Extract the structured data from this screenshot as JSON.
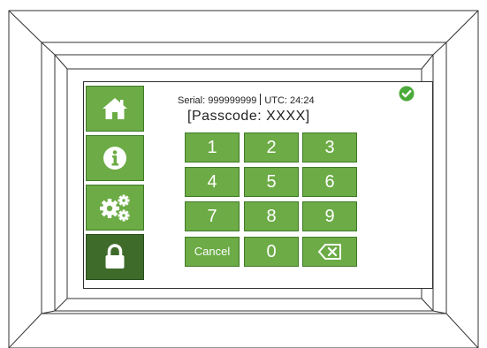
{
  "device": {
    "serial_label": "Serial:",
    "serial_value": "999999999",
    "utc_label": "UTC:",
    "utc_value": "24:24",
    "passcode_text": "[Passcode: XXXX]",
    "status": "ok"
  },
  "sidebar": {
    "items": [
      {
        "name": "home",
        "icon": "home-icon",
        "active": false
      },
      {
        "name": "info",
        "icon": "info-icon",
        "active": false
      },
      {
        "name": "settings",
        "icon": "gears-icon",
        "active": false
      },
      {
        "name": "lock",
        "icon": "lock-icon",
        "active": true
      }
    ]
  },
  "keypad": {
    "keys": [
      "1",
      "2",
      "3",
      "4",
      "5",
      "6",
      "7",
      "8",
      "9",
      "Cancel",
      "0"
    ],
    "backspace_icon": "backspace-icon"
  },
  "colors": {
    "button_green": "#6cab45",
    "button_active": "#3e6b2a",
    "check_green": "#4aaa3a"
  }
}
